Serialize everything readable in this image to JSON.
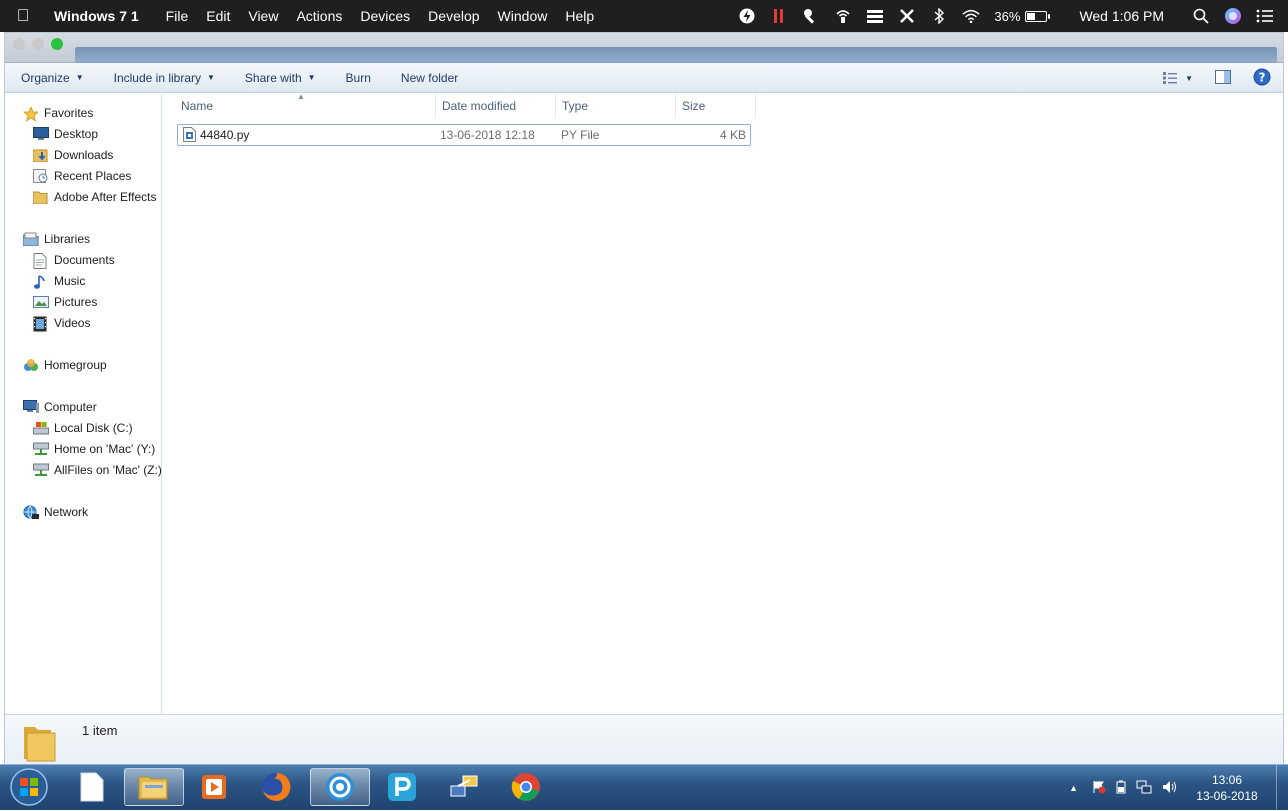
{
  "menubar": {
    "app_name": "Windows 7 1",
    "menus": [
      "File",
      "Edit",
      "View",
      "Actions",
      "Devices",
      "Develop",
      "Window",
      "Help"
    ],
    "battery_percent": "36%",
    "clock": "Wed 1:06 PM",
    "battery_level": 0.36
  },
  "toolbar": {
    "organize": "Organize",
    "include_in_library": "Include in library",
    "share_with": "Share with",
    "burn": "Burn",
    "new_folder": "New folder"
  },
  "nav": {
    "favorites": {
      "label": "Favorites",
      "items": [
        "Desktop",
        "Downloads",
        "Recent Places",
        "Adobe After Effects"
      ]
    },
    "libraries": {
      "label": "Libraries",
      "items": [
        "Documents",
        "Music",
        "Pictures",
        "Videos"
      ]
    },
    "homegroup": {
      "label": "Homegroup"
    },
    "computer": {
      "label": "Computer",
      "items": [
        "Local Disk (C:)",
        "Home on 'Mac' (Y:)",
        "AllFiles on 'Mac' (Z:)"
      ]
    },
    "network": {
      "label": "Network"
    }
  },
  "columns": {
    "name": "Name",
    "date_modified": "Date modified",
    "type": "Type",
    "size": "Size"
  },
  "files": [
    {
      "name": "44840.py",
      "date_modified": "13-06-2018 12:18",
      "type": "PY File",
      "size": "4 KB"
    }
  ],
  "details": {
    "item_count": "1 item"
  },
  "taskbar": {
    "time": "13:06",
    "date": "13-06-2018"
  }
}
